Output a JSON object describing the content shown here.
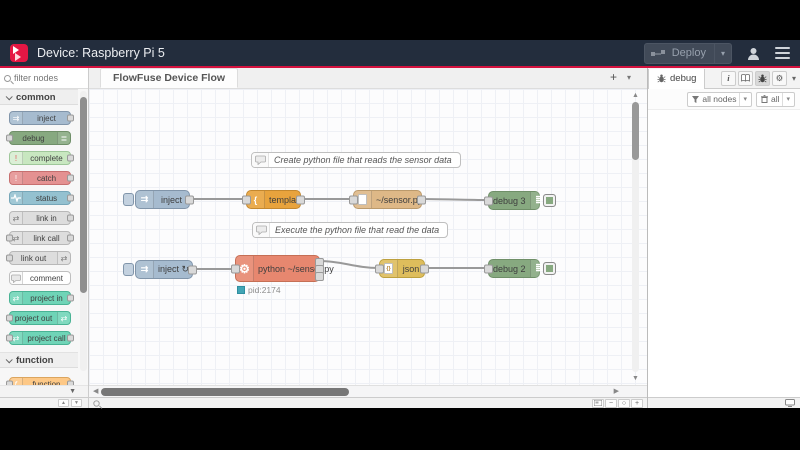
{
  "header": {
    "title": "Device: Raspberry Pi 5",
    "deploy_label": "Deploy"
  },
  "palette": {
    "filter_placeholder": "filter nodes",
    "categories": [
      {
        "label": "common"
      },
      {
        "label": "function"
      }
    ],
    "common_items": [
      "inject",
      "debug",
      "complete",
      "catch",
      "status",
      "link in",
      "link call",
      "link out",
      "comment",
      "project in",
      "project out",
      "project call"
    ],
    "function_items": [
      "function"
    ]
  },
  "workspace": {
    "tab": "FlowFuse Device Flow",
    "comments": [
      "Create python file that reads the sensor data",
      "Execute the python file that read the data"
    ],
    "nodes": {
      "inject1": "inject",
      "template": "template",
      "file": "~/sensor.py",
      "debug3": "debug 3",
      "inject2": "inject ↻",
      "exec": "python ~/sensor.py",
      "json": "json",
      "debug2": "debug 2"
    },
    "exec_status": "pid:2174"
  },
  "sidebar": {
    "tab_label": "debug",
    "filter_nodes_label": "all nodes",
    "clear_all_label": "all"
  },
  "icons": {
    "add": "+",
    "caret_down": "▾",
    "chevron_up": "▲",
    "chevron_down": "▼",
    "arrow_left": "◀",
    "arrow_right": "▶",
    "zoom_minus": "−",
    "zoom_reset": "○",
    "zoom_plus": "+",
    "gear": "⚙",
    "inject_arrows": "⇉",
    "debug_list": "≣",
    "exclaim": "!",
    "link_arrows": "⇄",
    "function_f": "ƒ",
    "brace": "{",
    "braces": "{}",
    "info": "i",
    "scroll_up": "▲",
    "scroll_down": "▼"
  },
  "colors": {
    "accent_red": "#d5113e",
    "header_bg": "#232d3d",
    "logo_red": "#e51744",
    "node_inject": "#a6bbcf",
    "node_debug": "#87a980",
    "node_complete": "#c8e7c0",
    "node_catch": "#e49191",
    "node_status": "#94c1d0",
    "node_link": "#dddddd",
    "node_comment": "#ffffff",
    "node_project": "#6fd4b7",
    "node_function": "#fdc886",
    "node_template": "#e8a33d",
    "node_file": "#deb887",
    "node_exec": "#e7876f",
    "node_json": "#debd5c",
    "status_dot": "#43a5b5",
    "wire": "#999999"
  }
}
